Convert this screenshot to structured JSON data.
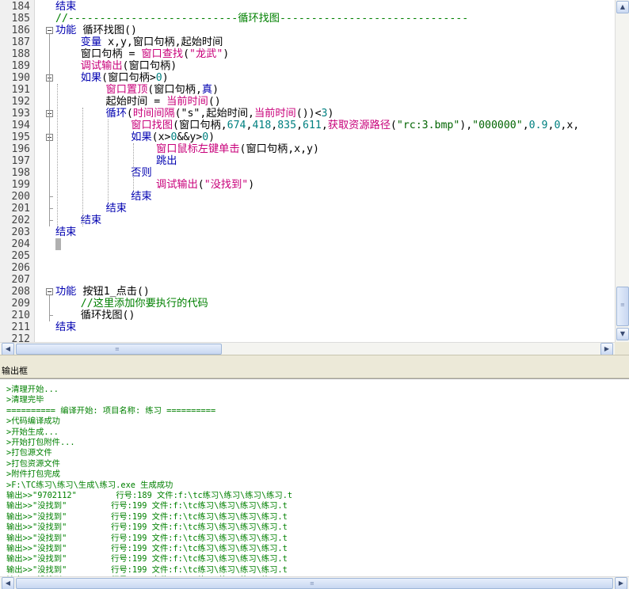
{
  "editor": {
    "lines": [
      {
        "num": "184",
        "tokens": [
          {
            "t": "结束",
            "c": "kw"
          }
        ]
      },
      {
        "num": "185",
        "tokens": [
          {
            "t": "//---------------------------循环找图------------------------------",
            "c": "cmt"
          }
        ]
      },
      {
        "num": "186",
        "tokens": [
          {
            "t": "功能",
            "c": "kw"
          },
          {
            "t": " 循环找图()",
            "c": ""
          }
        ]
      },
      {
        "num": "187",
        "tokens": [
          {
            "t": "    ",
            "c": ""
          },
          {
            "t": "变量",
            "c": "kw"
          },
          {
            "t": " x,y,窗口句柄,起始时间",
            "c": ""
          }
        ]
      },
      {
        "num": "188",
        "tokens": [
          {
            "t": "    窗口句柄 = ",
            "c": ""
          },
          {
            "t": "窗口查找",
            "c": "fn"
          },
          {
            "t": "(",
            "c": ""
          },
          {
            "t": "\"龙武\"",
            "c": "fn"
          },
          {
            "t": ")",
            "c": ""
          }
        ]
      },
      {
        "num": "189",
        "tokens": [
          {
            "t": "    ",
            "c": ""
          },
          {
            "t": "调试输出",
            "c": "fn"
          },
          {
            "t": "(窗口句柄)",
            "c": ""
          }
        ]
      },
      {
        "num": "190",
        "tokens": [
          {
            "t": "    ",
            "c": ""
          },
          {
            "t": "如果",
            "c": "kw"
          },
          {
            "t": "(窗口句柄>",
            "c": ""
          },
          {
            "t": "0",
            "c": "num"
          },
          {
            "t": ")",
            "c": ""
          }
        ]
      },
      {
        "num": "191",
        "tokens": [
          {
            "t": "        ",
            "c": ""
          },
          {
            "t": "窗口置顶",
            "c": "fn"
          },
          {
            "t": "(窗口句柄,",
            "c": ""
          },
          {
            "t": "真",
            "c": "kw"
          },
          {
            "t": ")",
            "c": ""
          }
        ]
      },
      {
        "num": "192",
        "tokens": [
          {
            "t": "        起始时间 = ",
            "c": ""
          },
          {
            "t": "当前时间",
            "c": "fn"
          },
          {
            "t": "()",
            "c": ""
          }
        ]
      },
      {
        "num": "193",
        "tokens": [
          {
            "t": "        ",
            "c": ""
          },
          {
            "t": "循环",
            "c": "kw"
          },
          {
            "t": "(",
            "c": ""
          },
          {
            "t": "时间间隔",
            "c": "fn"
          },
          {
            "t": "(\"s\",起始时间,",
            "c": ""
          },
          {
            "t": "当前时间",
            "c": "fn"
          },
          {
            "t": "())<",
            "c": ""
          },
          {
            "t": "3",
            "c": "num"
          },
          {
            "t": ")",
            "c": ""
          }
        ]
      },
      {
        "num": "194",
        "tokens": [
          {
            "t": "            ",
            "c": ""
          },
          {
            "t": "窗口找图",
            "c": "fn"
          },
          {
            "t": "(窗口句柄,",
            "c": ""
          },
          {
            "t": "674",
            "c": "num"
          },
          {
            "t": ",",
            "c": ""
          },
          {
            "t": "418",
            "c": "num"
          },
          {
            "t": ",",
            "c": ""
          },
          {
            "t": "835",
            "c": "num"
          },
          {
            "t": ",",
            "c": ""
          },
          {
            "t": "611",
            "c": "num"
          },
          {
            "t": ",",
            "c": ""
          },
          {
            "t": "获取资源路径",
            "c": "fn"
          },
          {
            "t": "(",
            "c": ""
          },
          {
            "t": "\"rc:3.bmp\"",
            "c": "str"
          },
          {
            "t": "),",
            "c": ""
          },
          {
            "t": "\"000000\"",
            "c": "str"
          },
          {
            "t": ",",
            "c": ""
          },
          {
            "t": "0.9",
            "c": "num"
          },
          {
            "t": ",",
            "c": ""
          },
          {
            "t": "0",
            "c": "num"
          },
          {
            "t": ",x,",
            "c": ""
          }
        ]
      },
      {
        "num": "195",
        "tokens": [
          {
            "t": "            ",
            "c": ""
          },
          {
            "t": "如果",
            "c": "kw"
          },
          {
            "t": "(x>",
            "c": ""
          },
          {
            "t": "0",
            "c": "num"
          },
          {
            "t": "&&y>",
            "c": ""
          },
          {
            "t": "0",
            "c": "num"
          },
          {
            "t": ")",
            "c": ""
          }
        ]
      },
      {
        "num": "196",
        "tokens": [
          {
            "t": "                ",
            "c": ""
          },
          {
            "t": "窗口鼠标左键单击",
            "c": "fn"
          },
          {
            "t": "(窗口句柄,x,y)",
            "c": ""
          }
        ]
      },
      {
        "num": "197",
        "tokens": [
          {
            "t": "                ",
            "c": ""
          },
          {
            "t": "跳出",
            "c": "kw"
          }
        ]
      },
      {
        "num": "198",
        "tokens": [
          {
            "t": "            ",
            "c": ""
          },
          {
            "t": "否则",
            "c": "kw"
          }
        ]
      },
      {
        "num": "199",
        "tokens": [
          {
            "t": "                ",
            "c": ""
          },
          {
            "t": "调试输出",
            "c": "fn"
          },
          {
            "t": "(",
            "c": ""
          },
          {
            "t": "\"没找到\"",
            "c": "fn"
          },
          {
            "t": ")",
            "c": ""
          }
        ]
      },
      {
        "num": "200",
        "tokens": [
          {
            "t": "            ",
            "c": ""
          },
          {
            "t": "结束",
            "c": "kw"
          }
        ]
      },
      {
        "num": "201",
        "tokens": [
          {
            "t": "        ",
            "c": ""
          },
          {
            "t": "结束",
            "c": "kw"
          }
        ]
      },
      {
        "num": "202",
        "tokens": [
          {
            "t": "    ",
            "c": ""
          },
          {
            "t": "结束",
            "c": "kw"
          }
        ]
      },
      {
        "num": "203",
        "tokens": [
          {
            "t": "结束",
            "c": "kw"
          }
        ]
      },
      {
        "num": "204",
        "tokens": []
      },
      {
        "num": "205",
        "tokens": []
      },
      {
        "num": "206",
        "tokens": []
      },
      {
        "num": "207",
        "tokens": []
      },
      {
        "num": "208",
        "tokens": [
          {
            "t": "功能",
            "c": "kw"
          },
          {
            "t": " 按钮1_点击()",
            "c": ""
          }
        ]
      },
      {
        "num": "209",
        "tokens": [
          {
            "t": "    //这里添加你要执行的代码",
            "c": "cmt"
          }
        ]
      },
      {
        "num": "210",
        "tokens": [
          {
            "t": "    循环找图()",
            "c": ""
          }
        ]
      },
      {
        "num": "211",
        "tokens": [
          {
            "t": "结束",
            "c": "kw"
          }
        ]
      },
      {
        "num": "212",
        "tokens": []
      }
    ]
  },
  "output": {
    "title": "输出框",
    "lines": [
      ">清理开始...",
      ">清理完毕",
      "========== 编译开始: 项目名称: 练习 ==========",
      ">代码编译成功",
      ">开始生成...",
      ">开始打包附件...",
      ">打包源文件",
      ">打包资源文件",
      ">附件打包完成",
      ">F:\\TC练习\\练习\\生成\\练习.exe 生成成功",
      "输出>>\"9702112\"        行号:189 文件:f:\\tc练习\\练习\\练习\\练习.t",
      "输出>>\"没找到\"         行号:199 文件:f:\\tc练习\\练习\\练习\\练习.t",
      "输出>>\"没找到\"         行号:199 文件:f:\\tc练习\\练习\\练习\\练习.t",
      "输出>>\"没找到\"         行号:199 文件:f:\\tc练习\\练习\\练习\\练习.t",
      "输出>>\"没找到\"         行号:199 文件:f:\\tc练习\\练习\\练习\\练习.t",
      "输出>>\"没找到\"         行号:199 文件:f:\\tc练习\\练习\\练习\\练习.t",
      "输出>>\"没找到\"         行号:199 文件:f:\\tc练习\\练习\\练习\\练习.t",
      "输出>>\"没找到\"         行号:199 文件:f:\\tc练习\\练习\\练习\\练习.t",
      "输出>>\"没找到\"         行号:199 文件:f:\\tc练习\\练习\\练习\\练习.t",
      "输出>>\"没找到\"         行号:199 文件:f:\\tc练习\\练习\\练习\\练习.t"
    ]
  },
  "scrollbars": {
    "up_arrow": "▲",
    "down_arrow": "▼",
    "left_arrow": "◀",
    "right_arrow": "▶",
    "grip": "≡"
  }
}
